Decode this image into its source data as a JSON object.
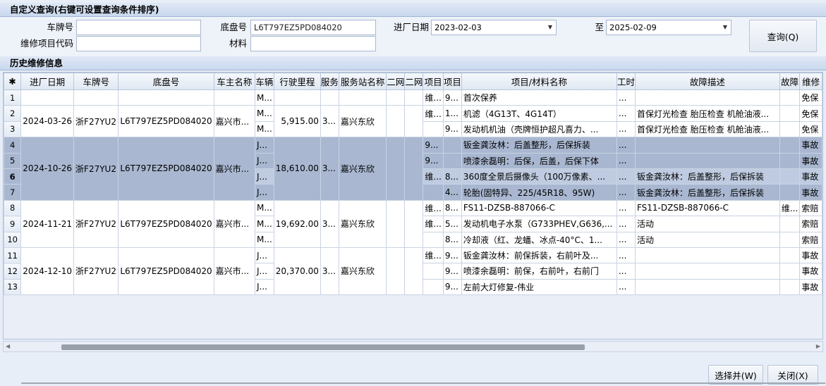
{
  "query": {
    "title": "自定义查询(右键可设置查询条件排序)",
    "plate_label": "车牌号",
    "plate_value": "",
    "chassis_label": "底盘号",
    "chassis_value": "L6T797EZ5PD084020",
    "date_label": "进厂日期",
    "date_from": "2023-02-03",
    "to_label": "至",
    "date_to": "2025-02-09",
    "repair_code_label": "维修项目代码",
    "repair_code_value": "",
    "material_label": "材料",
    "material_value": "",
    "query_button": "查询(Q)"
  },
  "history": {
    "title": "历史维修信息",
    "columns": [
      "✱",
      "进厂日期",
      "车牌号",
      "底盘号",
      "车主名称",
      "车辆",
      "行驶里程",
      "服务",
      "服务站名称",
      "二网",
      "二网",
      "项目",
      "项目",
      "项目/材料名称",
      "工时",
      "故障描述",
      "故障",
      "维修"
    ],
    "groups": [
      {
        "date": "",
        "plate": "",
        "chassis": "",
        "owner": "",
        "mileage": "",
        "svc": "",
        "station": "",
        "rows": [
          {
            "rn": "1",
            "veh": "M...",
            "t1": "维...",
            "t2": "9...",
            "item": "首次保养",
            "wk": "...",
            "fault": "",
            "fc": "",
            "rep": "免保"
          }
        ]
      },
      {
        "date": "2024-03-26",
        "plate": "浙F27YU2",
        "chassis": "L6T797EZ5PD084020",
        "owner": "嘉兴市...",
        "mileage": "5,915.00",
        "svc": "3...",
        "station": "嘉兴东欣",
        "rows": [
          {
            "rn": "2",
            "veh": "M...",
            "t1": "维...",
            "t2": "1...",
            "item": "机滤（4G13T、4G14T）",
            "wk": "...",
            "fault": "首保灯光检查 胎压检查 机舱油液...",
            "fc": "",
            "rep": "免保"
          },
          {
            "rn": "3",
            "veh": "M...",
            "t1": "",
            "t2": "9...",
            "item": "发动机机油（壳牌恒护超凡喜力、...",
            "wk": "...",
            "fault": "首保灯光检查 胎压检查 机舱油液...",
            "fc": "",
            "rep": "免保"
          }
        ]
      },
      {
        "date": "2024-10-26",
        "plate": "浙F27YU2",
        "chassis": "L6T797EZ5PD084020",
        "owner": "嘉兴市...",
        "mileage": "18,610.00",
        "svc": "3...",
        "station": "嘉兴东欣",
        "rows": [
          {
            "rn": "4",
            "veh": "J...",
            "t1": "9...",
            "t2": "",
            "item": "钣金龚汝林：后盖整形，后保拆装",
            "wk": "...",
            "fault": "",
            "fc": "",
            "rep": "事故"
          },
          {
            "rn": "5",
            "veh": "J...",
            "t1": "9...",
            "t2": "",
            "item": "喷漆余磊明：后保，后盖，后保下体",
            "wk": "...",
            "fault": "",
            "fc": "",
            "rep": "事故"
          },
          {
            "rn": "6",
            "veh": "J...",
            "t1": "维...",
            "t2": "8...",
            "item": "360度全景后摄像头（100万像素、...",
            "wk": "...",
            "fault": "钣金龚汝林：后盖整形，后保拆装",
            "fc": "",
            "rep": "事故"
          },
          {
            "rn": "7",
            "veh": "J...",
            "t1": "",
            "t2": "4...",
            "item": "轮胎(固特异、225/45R18、95W)",
            "wk": "...",
            "fault": "钣金龚汝林：后盖整形，后保拆装",
            "fc": "",
            "rep": "事故"
          }
        ]
      },
      {
        "date": "2024-11-21",
        "plate": "浙F27YU2",
        "chassis": "L6T797EZ5PD084020",
        "owner": "嘉兴市...",
        "mileage": "19,692.00",
        "svc": "3...",
        "station": "嘉兴东欣",
        "rows": [
          {
            "rn": "8",
            "veh": "M...",
            "t1": "维...",
            "t2": "8...",
            "item": "FS11-DZSB-887066-C",
            "wk": "...",
            "fault": "FS11-DZSB-887066-C",
            "fc": "维...",
            "rep": "索赔"
          },
          {
            "rn": "9",
            "veh": "M...",
            "t1": "维...",
            "t2": "5...",
            "item": "发动机电子水泵（G733PHEV,G636,...",
            "wk": "...",
            "fault": "活动",
            "fc": "",
            "rep": "索赔"
          },
          {
            "rn": "10",
            "veh": "M...",
            "t1": "",
            "t2": "8...",
            "item": "冷却液（红、龙蟠、冰点-40°C、1...",
            "wk": "...",
            "fault": "活动",
            "fc": "",
            "rep": "索赔"
          }
        ]
      },
      {
        "date": "2024-12-10",
        "plate": "浙F27YU2",
        "chassis": "L6T797EZ5PD084020",
        "owner": "嘉兴市...",
        "mileage": "20,370.00",
        "svc": "3...",
        "station": "嘉兴东欣",
        "rows": [
          {
            "rn": "11",
            "veh": "J...",
            "t1": "维...",
            "t2": "9...",
            "item": "钣金龚汝林：前保拆装，右前叶及...",
            "wk": "...",
            "fault": "",
            "fc": "",
            "rep": "事故"
          },
          {
            "rn": "12",
            "veh": "J...",
            "t1": "",
            "t2": "9...",
            "item": "喷漆余磊明：前保，右前叶，右前门",
            "wk": "...",
            "fault": "",
            "fc": "",
            "rep": "事故"
          },
          {
            "rn": "13",
            "veh": "J...",
            "t1": "",
            "t2": "9...",
            "item": "左前大灯修复-伟业",
            "wk": "...",
            "fault": "",
            "fc": "",
            "rep": "事故"
          }
        ]
      }
    ]
  },
  "footer": {
    "select_button": "选择并(W)",
    "close_button": "关闭(X)"
  }
}
